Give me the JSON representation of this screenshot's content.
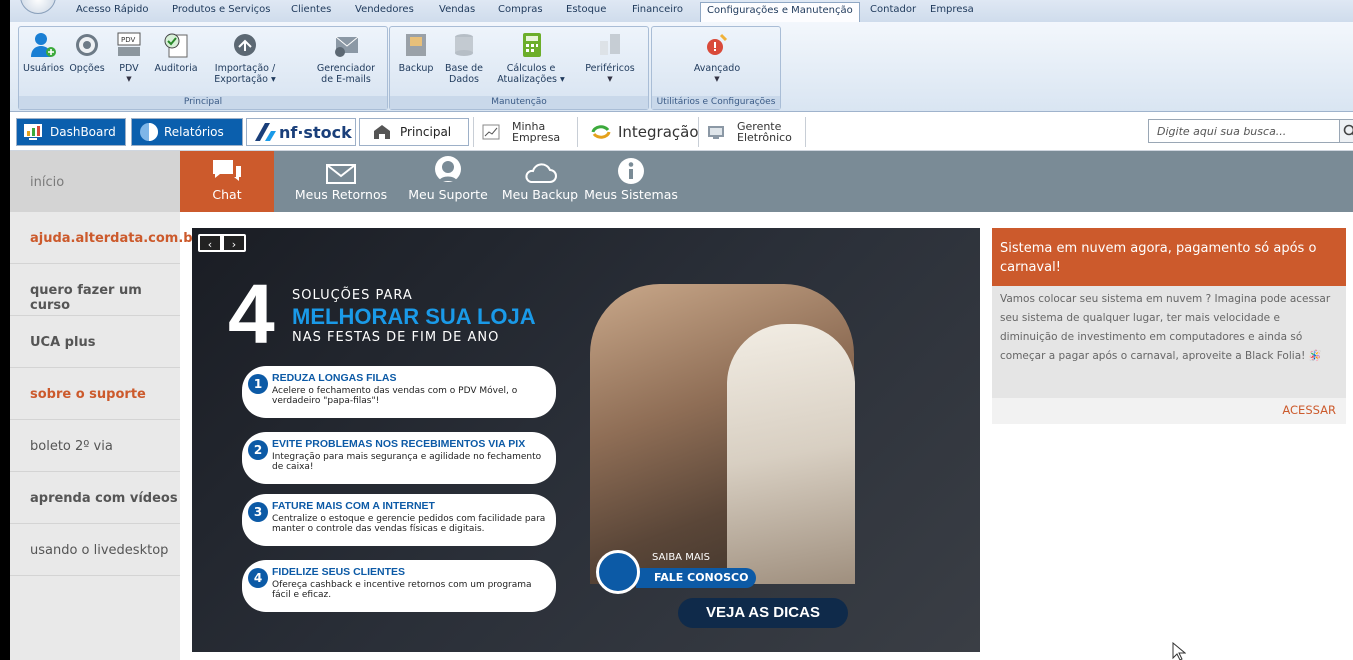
{
  "ribbon": {
    "tabs": [
      "Acesso Rápido",
      "Produtos e Serviços",
      "Clientes",
      "Vendedores",
      "Vendas",
      "Compras",
      "Estoque",
      "Financeiro",
      "Configurações e Manutenção",
      "Contador",
      "Empresa"
    ],
    "active_tab": "Configurações e Manutenção",
    "groups": {
      "principal": {
        "label": "Principal",
        "buttons": [
          "Usuários",
          "Opções",
          "PDV",
          "Auditoria",
          "Importação /",
          "Exportação",
          "Gerenciador",
          "de E-mails"
        ]
      },
      "manutencao": {
        "label": "Manutenção",
        "buttons": [
          "Backup",
          "Base de",
          "Dados",
          "Cálculos e",
          "Atualizações",
          "Periféricos"
        ]
      },
      "utilitarios": {
        "label": "Utilitários e Configurações",
        "buttons": [
          "Avançado"
        ]
      }
    }
  },
  "toolbar": {
    "dashboard": "DashBoard",
    "relatorios": "Relatórios",
    "nfstock": "nf·stock",
    "principal": "Principal",
    "minha_empresa_1": "Minha",
    "minha_empresa_2": "Empresa",
    "integracao": "Integração",
    "gerente_1": "Gerente",
    "gerente_2": "Eletrônico",
    "search_placeholder": "Digite aqui sua busca..."
  },
  "nav": {
    "inicio": "início",
    "items": [
      "Chat",
      "Meus Retornos",
      "Meu Suporte",
      "Meu Backup",
      "Meus Sistemas"
    ],
    "active": "Chat"
  },
  "sidebar": {
    "items": [
      "ajuda.alterdata.com.br",
      "quero fazer um curso",
      "UCA plus",
      "sobre o suporte",
      "boleto 2º via",
      "aprenda com vídeos",
      "usando o livedesktop"
    ]
  },
  "banner": {
    "number": "4",
    "line1": "SOLUÇÕES PARA",
    "line2": "MELHORAR SUA LOJA",
    "line3": "NAS FESTAS DE FIM DE ANO",
    "cards": [
      {
        "n": "1",
        "title": "REDUZA LONGAS FILAS",
        "desc": "Acelere o fechamento das vendas com o PDV Móvel, o verdadeiro \"papa-filas\"!"
      },
      {
        "n": "2",
        "title": "EVITE PROBLEMAS NOS RECEBIMENTOS VIA PIX",
        "desc": "Integração para mais segurança e agilidade no fechamento de caixa!"
      },
      {
        "n": "3",
        "title": "FATURE MAIS COM A INTERNET",
        "desc": "Centralize o estoque e gerencie pedidos com facilidade para manter o controle das vendas físicas e digitais."
      },
      {
        "n": "4",
        "title": "FIDELIZE SEUS CLIENTES",
        "desc": "Ofereça cashback e incentive retornos com um programa fácil e eficaz."
      }
    ],
    "saiba": "SAIBA MAIS",
    "fale": "FALE CONOSCO",
    "veja": "VEJA AS DICAS"
  },
  "news": {
    "title": "Sistema em nuvem agora, pagamento só após o carnaval!",
    "body": "Vamos colocar seu sistema em nuvem ? Imagina pode acessar seu sistema de qualquer lugar, ter mais velocidade e diminuição de investimento em computadores e ainda só começar a pagar após o carnaval, aproveite a Black Folia! 🪅",
    "link": "ACESSAR"
  },
  "colors": {
    "accent": "#cc5a2c",
    "nav": "#7a8b96",
    "brand_blue": "#0c5aa6"
  }
}
